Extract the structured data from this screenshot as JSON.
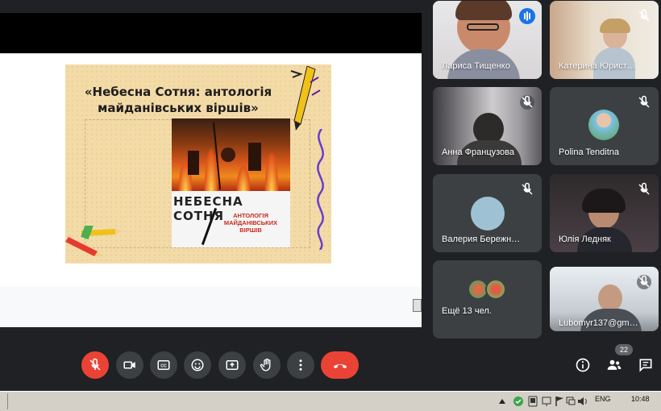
{
  "slide": {
    "title_line1": "«Небесна Сотня: антологія",
    "title_line2": "майданівських віршів»",
    "book_title": "НЕБЕСНА СОТНЯ",
    "book_subtitle": "АНТОЛОГІЯ МАЙДАНІВСЬКИХ ВІРШІВ"
  },
  "participants": [
    {
      "name": "Лариса Тищенко",
      "speaking": true
    },
    {
      "name": "Катерина Юрист…",
      "muted": true
    },
    {
      "name": "Анна Французова",
      "muted": true
    },
    {
      "name": "Polina Tenditna",
      "muted": true
    },
    {
      "name": "Валерия Бережн…",
      "muted": true
    },
    {
      "name": "Юлія Ледняк",
      "muted": true
    },
    {
      "name": "Ещё 13 чел."
    },
    {
      "name": "Lubomyr137@gm…",
      "muted": true
    }
  ],
  "controls": {
    "mic": "mic-off-icon",
    "camera": "camera-icon",
    "captions": "captions-icon",
    "emoji": "emoji-icon",
    "present": "present-icon",
    "hand": "raise-hand-icon",
    "more": "more-vert-icon",
    "end": "end-call-icon"
  },
  "right_controls": {
    "people_count": "22"
  },
  "taskbar": {
    "lang": "ENG",
    "time": "10:48"
  },
  "colors": {
    "background": "#202124",
    "tile": "#3c4043",
    "red": "#ea4335",
    "active_border": "#8ab4f8",
    "speaking": "#1a73e8"
  }
}
